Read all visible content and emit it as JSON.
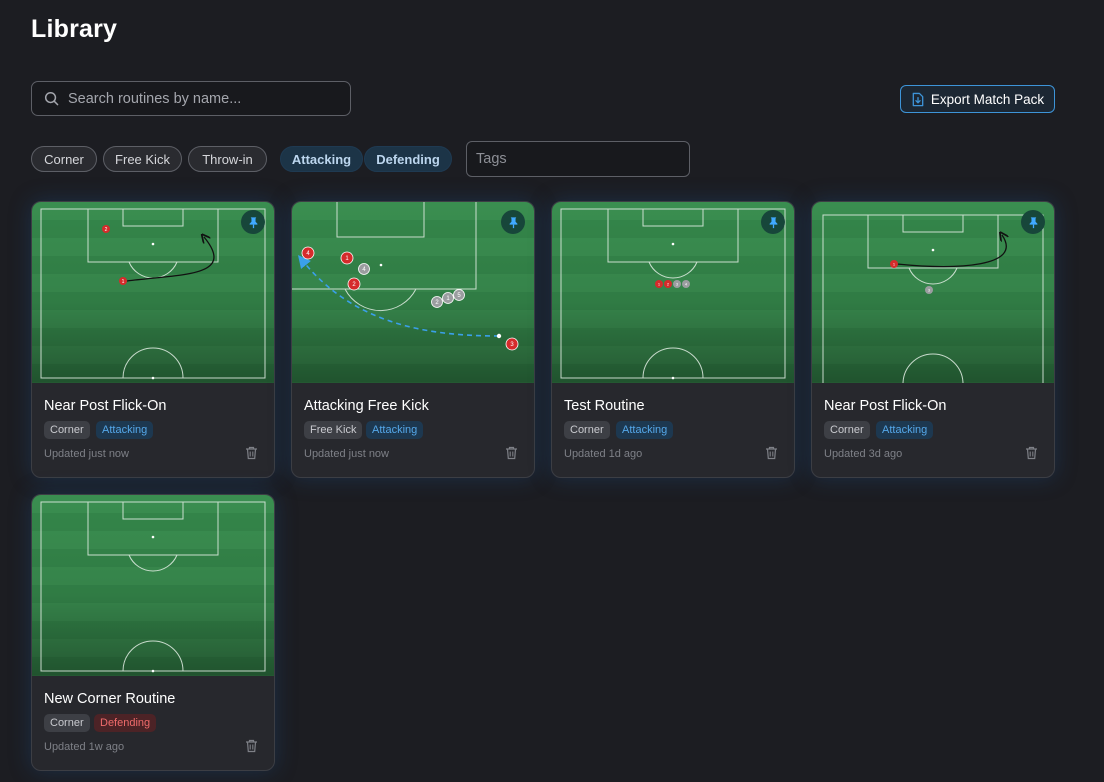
{
  "page": {
    "title": "Library"
  },
  "search": {
    "placeholder": "Search routines by name..."
  },
  "export": {
    "label": "Export Match Pack"
  },
  "filters": {
    "set_piece": [
      "Corner",
      "Free Kick",
      "Throw-in"
    ],
    "phase": [
      "Attacking",
      "Defending"
    ],
    "tags_placeholder": "Tags"
  },
  "cards": [
    {
      "title": "Near Post Flick-On",
      "tags": [
        "Corner",
        "Attacking"
      ],
      "updated": "Updated just now",
      "pinned": true
    },
    {
      "title": "Attacking Free Kick",
      "tags": [
        "Free Kick",
        "Attacking"
      ],
      "updated": "Updated just now",
      "pinned": true
    },
    {
      "title": "Test Routine",
      "tags": [
        "Corner",
        "Attacking"
      ],
      "updated": "Updated 1d ago",
      "pinned": true
    },
    {
      "title": "Near Post Flick-On",
      "tags": [
        "Corner",
        "Attacking"
      ],
      "updated": "Updated 3d ago",
      "pinned": true
    },
    {
      "title": "New Corner Routine",
      "tags": [
        "Corner",
        "Defending"
      ],
      "updated": "Updated 1w ago",
      "pinned": false
    }
  ],
  "player_markers": {
    "card_1": [
      "1",
      "2"
    ],
    "card_2": [
      "4",
      "1",
      "4",
      "2",
      "2",
      "1",
      "5",
      "3"
    ],
    "card_3": [
      "1",
      "2",
      "3",
      "4"
    ],
    "card_4": [
      "1",
      "3"
    ]
  },
  "colors": {
    "accent": "#3d94d8",
    "pitch_dark": "#1e5a30",
    "pitch_light": "#3a9352",
    "attacking_tag": "#55a8ea",
    "defending_tag": "#ef6b6b",
    "player_red": "#d52b2b",
    "player_grey": "#9b9da0"
  },
  "icons": {
    "search": "search-icon",
    "export": "file-export-icon",
    "pin": "pin-icon",
    "delete": "trash-icon"
  }
}
